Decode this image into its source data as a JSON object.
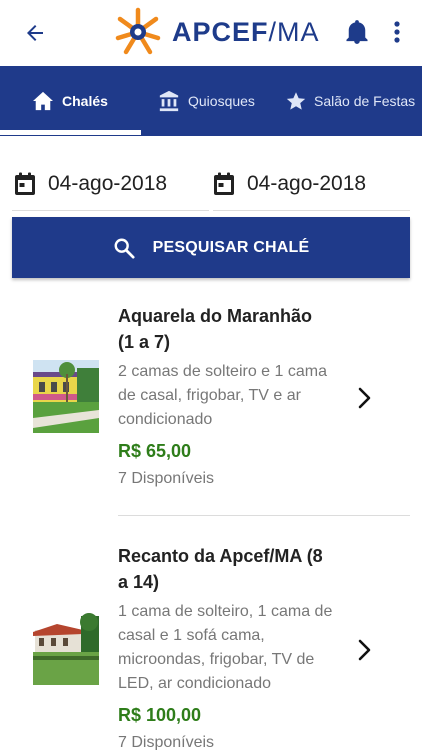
{
  "appbar": {
    "brand_bold": "APCEF",
    "brand_suffix": "/MA",
    "icons": {
      "back": "arrow-left-icon",
      "bell": "bell-icon",
      "more": "more-vert-icon"
    },
    "colors": {
      "brand_blue": "#1e3b8a",
      "logo_orange": "#f08a1c"
    }
  },
  "tabs": [
    {
      "label": "Chalés",
      "icon": "home-icon",
      "active": true
    },
    {
      "label": "Quiosques",
      "icon": "bank-icon",
      "active": false
    },
    {
      "label": "Salão de Festas",
      "icon": "star-icon",
      "active": false
    }
  ],
  "search": {
    "date_from": "04-ago-2018",
    "date_to": "04-ago-2018",
    "button_label": "PESQUISAR CHALÉ",
    "icons": {
      "calendar": "calendar-icon",
      "search": "search-icon"
    }
  },
  "results": [
    {
      "title": "Aquarela do Maranhão (1 a 7)",
      "description": "2 camas de solteiro e 1 cama de casal, frigobar, TV e ar condicionado",
      "price": "R$ 65,00",
      "availability": "7 Disponíveis"
    },
    {
      "title": "Recanto da Apcef/MA (8 a 14)",
      "description": "1 cama de solteiro, 1 cama de casal e 1 sofá cama, microondas, frigobar, TV de LED, ar condicionado",
      "price": "R$ 100,00",
      "availability": "7 Disponíveis"
    }
  ],
  "theme": {
    "primary": "#1f3a8a",
    "price_green": "#2e7d1a",
    "muted_text": "#777777"
  }
}
